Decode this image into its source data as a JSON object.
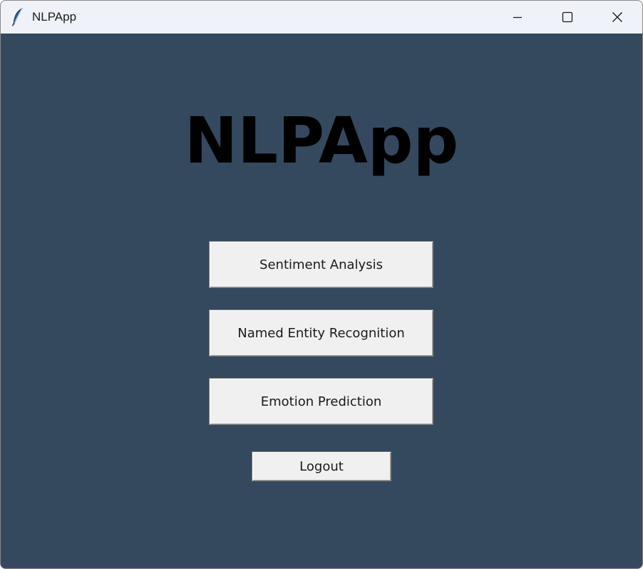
{
  "window": {
    "title": "NLPApp",
    "icon": "feather-icon",
    "controls": [
      "minimize-icon",
      "maximize-icon",
      "close-icon"
    ]
  },
  "main": {
    "heading": "NLPApp",
    "background_color": "#34495e",
    "buttons": {
      "sentiment": "Sentiment Analysis",
      "ner": "Named Entity Recognition",
      "emotion": "Emotion Prediction",
      "logout": "Logout"
    }
  }
}
